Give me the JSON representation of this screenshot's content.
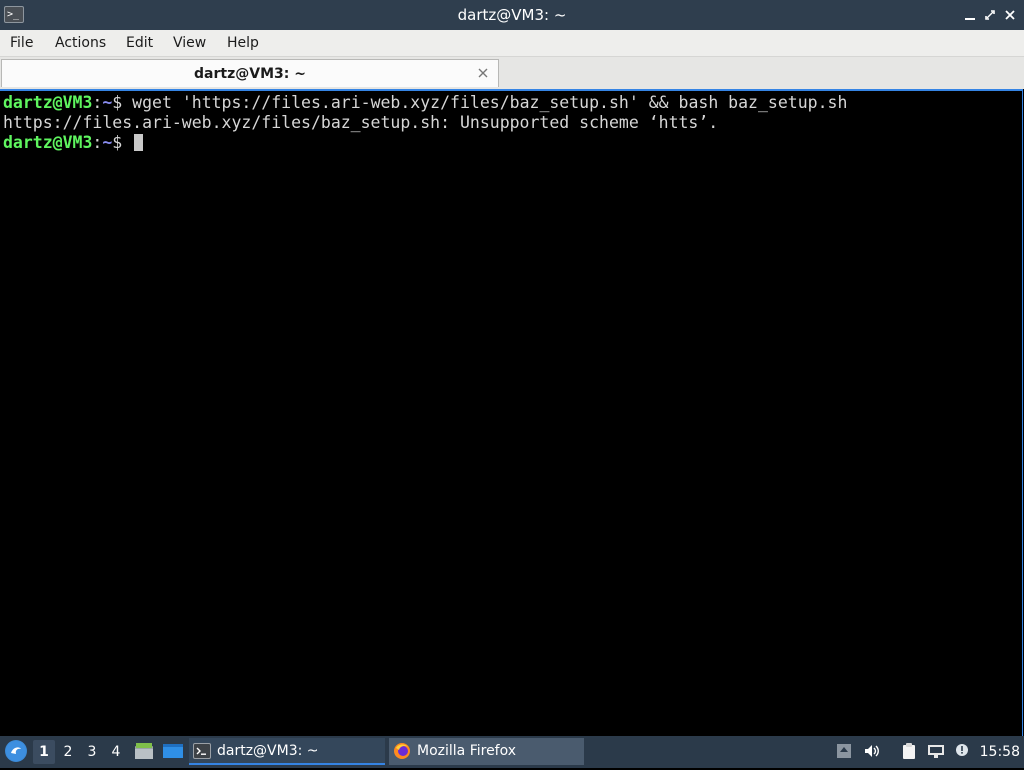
{
  "window": {
    "title": "dartz@VM3: ~",
    "app_icon": "terminal-icon",
    "controls": [
      "minimize-icon",
      "restore-icon",
      "close-icon"
    ]
  },
  "menu": {
    "file": "File",
    "actions": "Actions",
    "edit": "Edit",
    "view": "View",
    "help": "Help"
  },
  "tab": {
    "label": "dartz@VM3: ~",
    "close_icon": "close-icon"
  },
  "terminal": {
    "lines": [
      {
        "user": "dartz@VM3",
        "sep": ":",
        "path": "~",
        "sym": "$ ",
        "text": "wget 'https://files.ari-web.xyz/files/baz_setup.sh' && bash baz_setup.sh"
      },
      {
        "output": "https://files.ari-web.xyz/files/baz_setup.sh: Unsupported scheme ‘htts’."
      },
      {
        "user": "dartz@VM3",
        "sep": ":",
        "path": "~",
        "sym": "$ ",
        "text": ""
      }
    ]
  },
  "taskbar": {
    "start_icon": "lxqt-start-icon",
    "workspaces": [
      "1",
      "2",
      "3",
      "4"
    ],
    "active_workspace": "1",
    "quicklaunch": [
      "file-manager-icon",
      "show-desktop-icon"
    ],
    "tasks": [
      {
        "label": "dartz@VM3: ~",
        "icon": "terminal-icon",
        "active": true
      },
      {
        "label": "Mozilla Firefox",
        "icon": "firefox-icon",
        "active": false
      }
    ],
    "tray": [
      "update-icon",
      "volume-icon",
      "clipboard-icon",
      "network-icon",
      "notification-icon"
    ],
    "clock": "15:58"
  },
  "colors": {
    "titlebar": "#2f3e4e",
    "taskbar": "#2b3a4a",
    "prompt_user": "#5ff55f",
    "prompt_path": "#8a8df0",
    "focus_border": "#3584e4"
  }
}
